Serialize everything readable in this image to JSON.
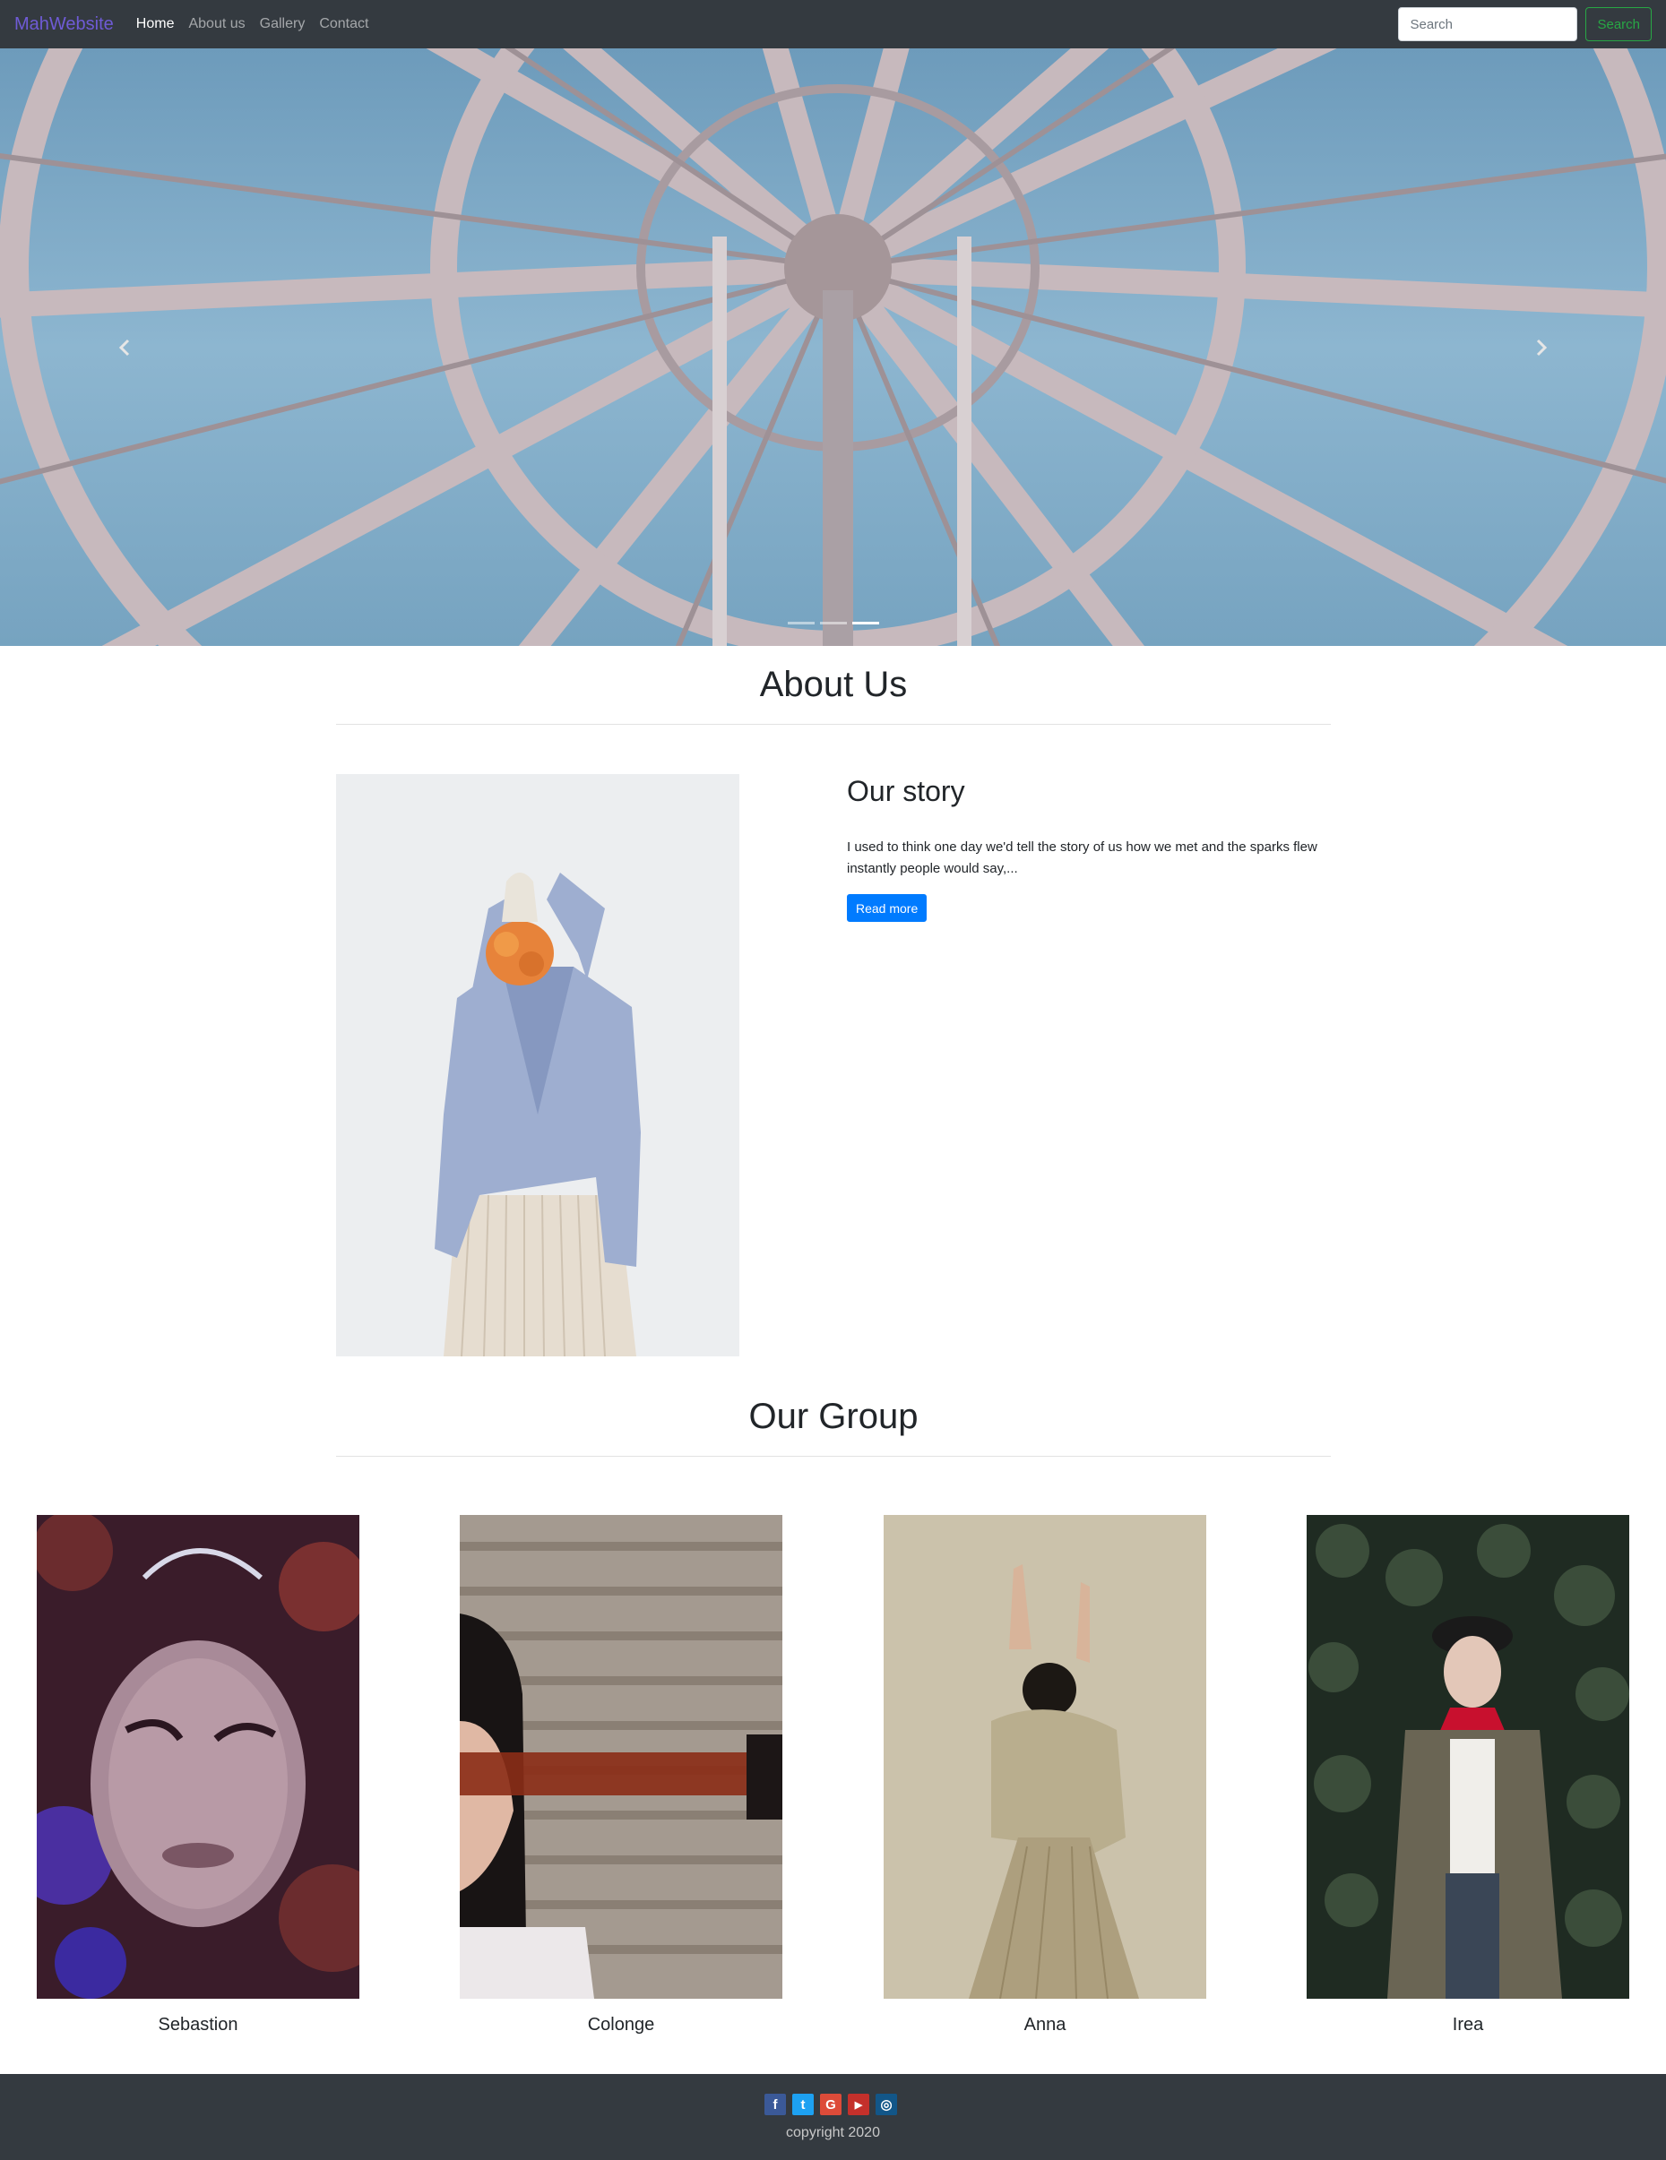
{
  "navbar": {
    "brand": "MahWebsite",
    "links": [
      {
        "label": "Home",
        "active": true
      },
      {
        "label": "About us",
        "active": false
      },
      {
        "label": "Gallery",
        "active": false
      },
      {
        "label": "Contact",
        "active": false
      }
    ],
    "search_placeholder": "Search",
    "search_button": "Search"
  },
  "carousel": {
    "prev_icon": "chevron-left-icon",
    "next_icon": "chevron-right-icon",
    "indicator_count": 3,
    "active_indicator": 3
  },
  "about": {
    "title": "About Us",
    "story_title": "Our story",
    "story_text": "I used to think one day we'd tell the story of us how we met and the sparks flew instantly people would say,...",
    "read_more": "Read more"
  },
  "group": {
    "title": "Our Group",
    "members": [
      {
        "name": "Sebastion"
      },
      {
        "name": "Colonge"
      },
      {
        "name": "Anna"
      },
      {
        "name": "Irea"
      }
    ]
  },
  "footer": {
    "social": [
      {
        "icon": "facebook-icon",
        "glyph": "f",
        "color": "#3b5998"
      },
      {
        "icon": "twitter-icon",
        "glyph": "t",
        "color": "#1da1f2"
      },
      {
        "icon": "google-icon",
        "glyph": "G",
        "color": "#dd4b39"
      },
      {
        "icon": "youtube-icon",
        "glyph": "▶",
        "color": "#c4302b"
      },
      {
        "icon": "instagram-icon",
        "glyph": "◎",
        "color": "#125688"
      }
    ],
    "copyright": "copyright 2020"
  },
  "colors": {
    "navbar_bg": "#343a40",
    "brand": "#6f5bd6",
    "success": "#28a745",
    "primary": "#007bff"
  }
}
